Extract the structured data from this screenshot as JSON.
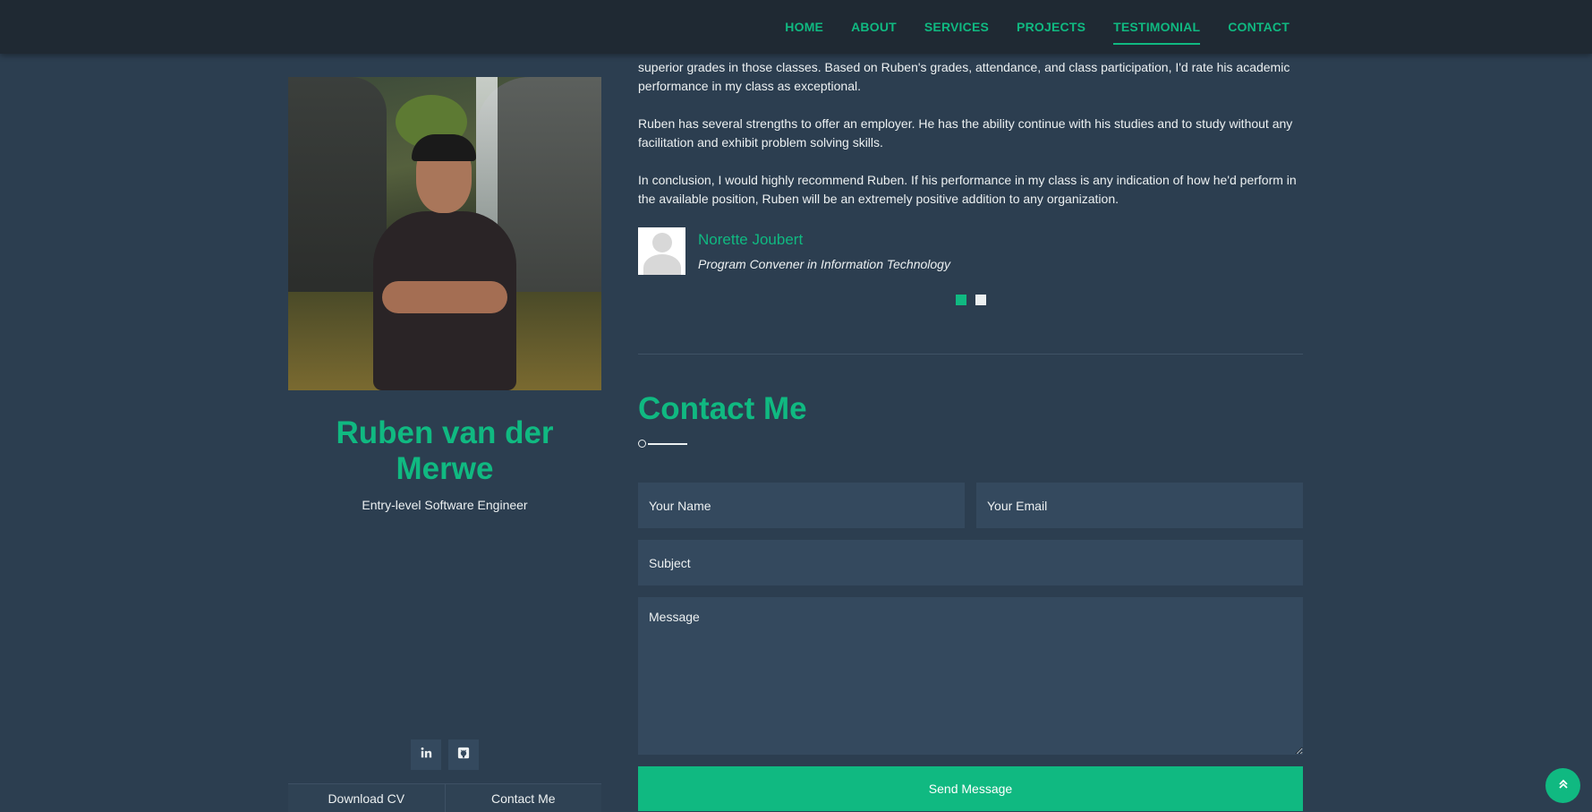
{
  "nav": {
    "items": [
      {
        "label": "HOME"
      },
      {
        "label": "ABOUT"
      },
      {
        "label": "SERVICES"
      },
      {
        "label": "PROJECTS"
      },
      {
        "label": "TESTIMONIAL"
      },
      {
        "label": "CONTACT"
      }
    ],
    "active": "TESTIMONIAL"
  },
  "profile": {
    "name": "Ruben van der Merwe",
    "title": "Entry-level Software Engineer",
    "social": [
      "linkedin-icon",
      "github-icon"
    ],
    "download_cv_label": "Download CV",
    "contact_label": "Contact Me"
  },
  "testimonial": {
    "paragraphs": [
      "superior grades in those classes. Based on Ruben's grades, attendance, and class participation, I'd rate his academic performance in my class as exceptional.",
      "Ruben has several strengths to offer an employer. He has the ability continue with his studies and to study without any facilitation and exhibit problem solving skills.",
      "In conclusion, I would highly recommend Ruben. If his performance in my class is any indication of how he'd perform in the available position, Ruben will be an extremely positive addition to any organization."
    ],
    "author_name": "Norette Joubert",
    "author_role": "Program Convener in Information Technology",
    "slides_total": 2,
    "slide_active": 1
  },
  "contact": {
    "title": "Contact Me",
    "name_placeholder": "Your Name",
    "email_placeholder": "Your Email",
    "subject_placeholder": "Subject",
    "message_placeholder": "Message",
    "send_label": "Send Message"
  },
  "colors": {
    "accent": "#10b981",
    "background": "#2c3e50",
    "nav_background": "#1f2933",
    "field_background": "#34495e"
  }
}
